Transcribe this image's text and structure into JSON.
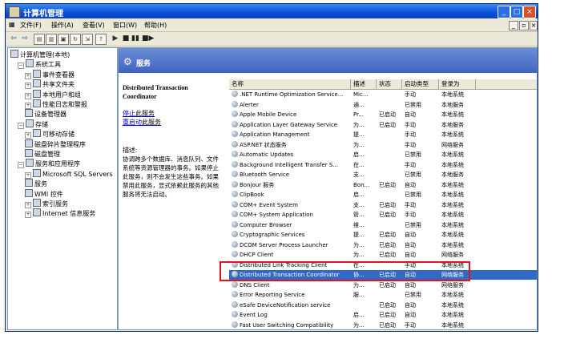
{
  "window": {
    "title": "计算机管理",
    "buttons": [
      "minimize",
      "maximize",
      "close"
    ]
  },
  "menu": [
    "文件(F)",
    "操作(A)",
    "查看(V)",
    "窗口(W)",
    "帮助(H)"
  ],
  "toolbar_icons": [
    "back-arrow-icon",
    "forward-arrow-icon",
    "up-folder-icon",
    "show-tree-icon",
    "properties-icon",
    "refresh-icon",
    "export-icon",
    "help-icon",
    "play-icon",
    "stop-icon",
    "pause-icon",
    "restart-icon"
  ],
  "tree": [
    {
      "label": "计算机管理(本地)",
      "level": 0,
      "expand": ""
    },
    {
      "label": "系统工具",
      "level": 1,
      "expand": "−"
    },
    {
      "label": "事件查看器",
      "level": 2,
      "expand": "+"
    },
    {
      "label": "共享文件夹",
      "level": 2,
      "expand": "+"
    },
    {
      "label": "本地用户和组",
      "level": 2,
      "expand": "+"
    },
    {
      "label": "性能日志和警报",
      "level": 2,
      "expand": "+"
    },
    {
      "label": "设备管理器",
      "level": 2,
      "expand": ""
    },
    {
      "label": "存储",
      "level": 1,
      "expand": "−"
    },
    {
      "label": "可移动存储",
      "level": 2,
      "expand": "+"
    },
    {
      "label": "磁盘碎片整理程序",
      "level": 2,
      "expand": ""
    },
    {
      "label": "磁盘管理",
      "level": 2,
      "expand": ""
    },
    {
      "label": "服务和应用程序",
      "level": 1,
      "expand": "−"
    },
    {
      "label": "Microsoft SQL Servers",
      "level": 2,
      "expand": "+"
    },
    {
      "label": "服务",
      "level": 2,
      "expand": ""
    },
    {
      "label": "WMI 控件",
      "level": 2,
      "expand": ""
    },
    {
      "label": "索引服务",
      "level": 2,
      "expand": "+"
    },
    {
      "label": "Internet 信息服务",
      "level": 2,
      "expand": "+"
    }
  ],
  "panel": {
    "title": "服务",
    "service_name": "Distributed Transaction Coordinator",
    "stop_link": "停止",
    "stop_suffix": "此服务",
    "restart_link": "重启动",
    "restart_suffix": "此服务",
    "desc_label": "描述:",
    "description": "协调跨多个数据库、消息队列、文件系统等资源管理器的事务。如果停止此服务，则不会发生这些事务。如果禁用此服务，显式依赖此服务的其他服务将无法启动。"
  },
  "columns": [
    "名称",
    "描述",
    "状态",
    "启动类型",
    "登录为"
  ],
  "services": [
    {
      "name": ".NET Runtime Optimization Service...",
      "desc": "Mic...",
      "status": "",
      "startup": "手动",
      "logon": "本地系统"
    },
    {
      "name": "Alerter",
      "desc": "通...",
      "status": "",
      "startup": "已禁用",
      "logon": "本地服务"
    },
    {
      "name": "Apple Mobile Device",
      "desc": "Pr...",
      "status": "已启动",
      "startup": "自动",
      "logon": "本地系统"
    },
    {
      "name": "Application Layer Gateway Service",
      "desc": "为...",
      "status": "已启动",
      "startup": "手动",
      "logon": "本地服务"
    },
    {
      "name": "Application Management",
      "desc": "提...",
      "status": "",
      "startup": "手动",
      "logon": "本地系统"
    },
    {
      "name": "ASP.NET 状态服务",
      "desc": "为...",
      "status": "",
      "startup": "手动",
      "logon": "网络服务"
    },
    {
      "name": "Automatic Updates",
      "desc": "启...",
      "status": "",
      "startup": "已禁用",
      "logon": "本地系统"
    },
    {
      "name": "Background Intelligent Transfer S...",
      "desc": "在...",
      "status": "",
      "startup": "手动",
      "logon": "本地系统"
    },
    {
      "name": "Bluetooth Service",
      "desc": "支...",
      "status": "",
      "startup": "已禁用",
      "logon": "本地服务"
    },
    {
      "name": "Bonjour 服务",
      "desc": "Bon...",
      "status": "已启动",
      "startup": "自动",
      "logon": "本地系统"
    },
    {
      "name": "ClipBook",
      "desc": "启...",
      "status": "",
      "startup": "已禁用",
      "logon": "本地系统"
    },
    {
      "name": "COM+ Event System",
      "desc": "支...",
      "status": "已启动",
      "startup": "手动",
      "logon": "本地系统"
    },
    {
      "name": "COM+ System Application",
      "desc": "管...",
      "status": "已启动",
      "startup": "手动",
      "logon": "本地系统"
    },
    {
      "name": "Computer Browser",
      "desc": "维...",
      "status": "",
      "startup": "已禁用",
      "logon": "本地系统"
    },
    {
      "name": "Cryptographic Services",
      "desc": "提...",
      "status": "已启动",
      "startup": "自动",
      "logon": "本地系统"
    },
    {
      "name": "DCOM Server Process Launcher",
      "desc": "为...",
      "status": "已启动",
      "startup": "自动",
      "logon": "本地系统"
    },
    {
      "name": "DHCP Client",
      "desc": "为...",
      "status": "已启动",
      "startup": "自动",
      "logon": "网络服务"
    },
    {
      "name": "Distributed Link Tracking Client",
      "desc": "在...",
      "status": "",
      "startup": "手动",
      "logon": "本地系统"
    },
    {
      "name": "Distributed Transaction Coordinator",
      "desc": "协...",
      "status": "已启动",
      "startup": "自动",
      "logon": "网络服务",
      "selected": true
    },
    {
      "name": "DNS Client",
      "desc": "为...",
      "status": "已启动",
      "startup": "自动",
      "logon": "网络服务"
    },
    {
      "name": "Error Reporting Service",
      "desc": "服...",
      "status": "",
      "startup": "已禁用",
      "logon": "本地系统"
    },
    {
      "name": "eSafe DeviceNotification service",
      "desc": "",
      "status": "已启动",
      "startup": "自动",
      "logon": "本地系统"
    },
    {
      "name": "Event Log",
      "desc": "启...",
      "status": "已启动",
      "startup": "自动",
      "logon": "本地系统"
    },
    {
      "name": "Fast User Switching Compatibility",
      "desc": "为...",
      "status": "已启动",
      "startup": "手动",
      "logon": "本地系统"
    }
  ],
  "highlight_color": "#e0141c"
}
